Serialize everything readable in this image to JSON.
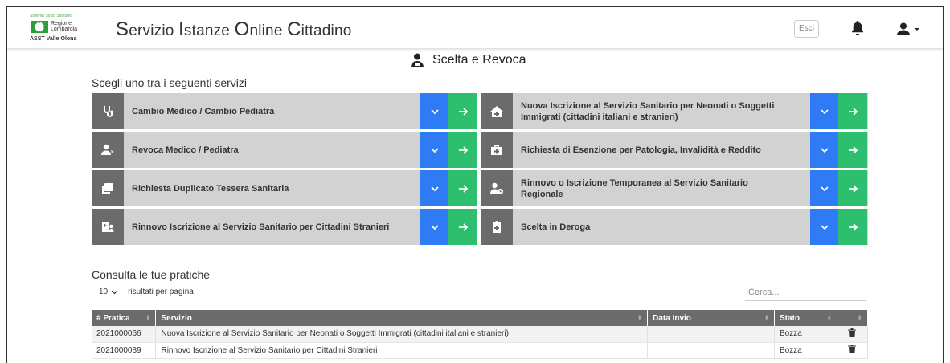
{
  "header": {
    "logo": {
      "line1": "Sistema Socio Sanitario",
      "line2a": "Regione",
      "line2b": "Lombardia",
      "line3": "ASST Valle Olona"
    },
    "title": {
      "w1_cap": "S",
      "w1_rest": "ervizio ",
      "w2_cap": "I",
      "w2_rest": "stanze ",
      "w3_cap": "O",
      "w3_rest": "nline ",
      "w4_cap": "C",
      "w4_rest": "ittadino"
    },
    "logout_label": "Esci",
    "icons": {
      "notifications": "bell-icon",
      "user_menu": "user-icon"
    }
  },
  "page": {
    "title": "Scelta e Revoca",
    "services_heading": "Scegli uno tra i seguenti servizi",
    "services": [
      {
        "label": "Cambio Medico / Cambio Pediatra",
        "icon": "stethoscope-icon"
      },
      {
        "label": "Nuova Iscrizione al Servizio Sanitario per Neonati o Soggetti Immigrati (cittadini italiani e stranieri)",
        "icon": "house-plus-icon"
      },
      {
        "label": "Revoca Medico / Pediatra",
        "icon": "user-remove-icon"
      },
      {
        "label": "Richiesta di Esenzione per Patologia, Invalidità e Reddito",
        "icon": "medkit-icon"
      },
      {
        "label": "Richiesta Duplicato Tessera Sanitaria",
        "icon": "clone-icon"
      },
      {
        "label": "Rinnovo o Iscrizione Temporanea al Servizio Sanitario Regionale",
        "icon": "user-clock-icon"
      },
      {
        "label": "Rinnovo Iscrizione al Servizio Sanitario per Cittadini Stranieri",
        "icon": "hospital-user-icon"
      },
      {
        "label": "Scelta in Deroga",
        "icon": "clipboard-plus-icon"
      }
    ],
    "colors": {
      "expand": "#2f7af5",
      "go": "#2ebf6e",
      "icon_bg": "#6b6b6b",
      "row_bg": "#d2d2d2"
    }
  },
  "consulta": {
    "heading": "Consulta le tue pratiche",
    "page_size": "10",
    "page_size_label": "risultati per pagina",
    "search_placeholder": "Cerca...",
    "columns": [
      "# Pratica",
      "Servizio",
      "Data Invio",
      "Stato",
      ""
    ],
    "rows": [
      {
        "pratica": "2021000066",
        "servizio": "Nuova Iscrizione al Servizio Sanitario per Neonati o Soggetti Immigrati (cittadini italiani e stranieri)",
        "data_invio": "",
        "stato": "Bozza"
      },
      {
        "pratica": "2021000089",
        "servizio": "Rinnovo Iscrizione al Servizio Sanitario per Cittadini Stranieri",
        "data_invio": "",
        "stato": "Bozza"
      }
    ]
  }
}
